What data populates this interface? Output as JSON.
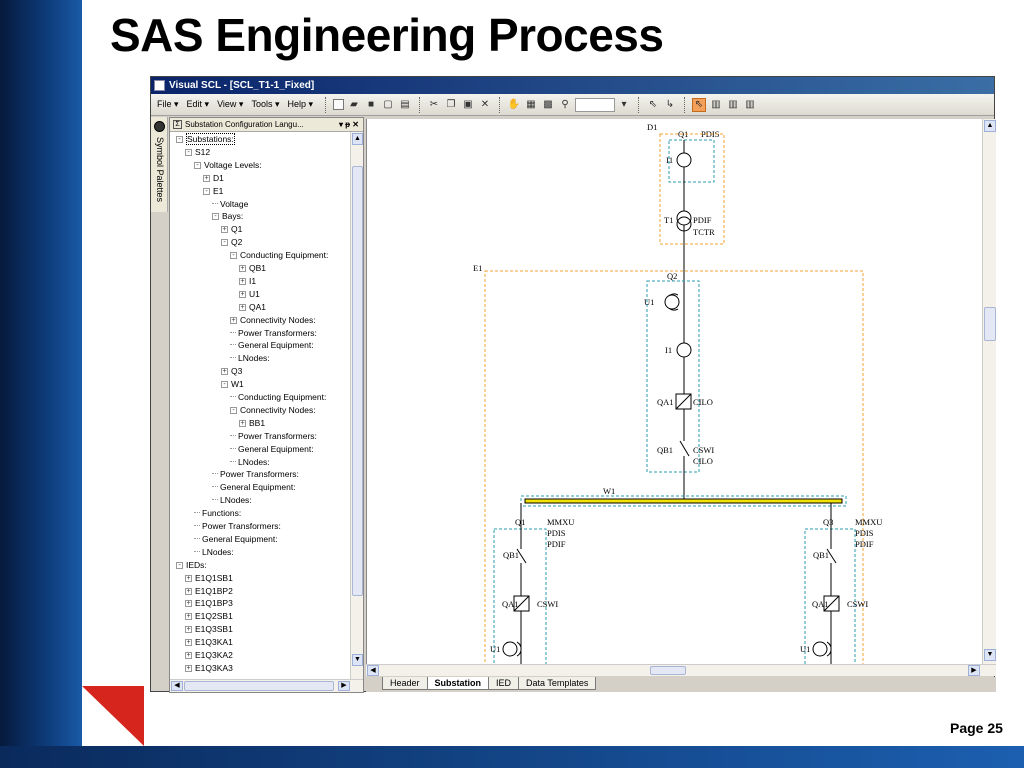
{
  "slide": {
    "title": "SAS Engineering Process",
    "page": "Page 25"
  },
  "window": {
    "title": "Visual SCL - [SCL_T1-1_Fixed]"
  },
  "menu": [
    "File ▾",
    "Edit ▾",
    "View ▾",
    "Tools ▾",
    "Help ▾"
  ],
  "palette": {
    "label": "Symbol Palettes"
  },
  "tree": {
    "header": "Substation Configuration Langu...",
    "header_controls": "▾ ᵽ ✕",
    "items": [
      {
        "label": "Substations:",
        "toggle": "-",
        "level": 0,
        "selected": true
      },
      {
        "label": "S12",
        "toggle": "-",
        "level": 1
      },
      {
        "label": "Voltage Levels:",
        "toggle": "-",
        "level": 2
      },
      {
        "label": "D1",
        "toggle": "+",
        "level": 3
      },
      {
        "label": "E1",
        "toggle": "-",
        "level": 3
      },
      {
        "label": "Voltage",
        "toggle": "",
        "level": 4
      },
      {
        "label": "Bays:",
        "toggle": "-",
        "level": 4
      },
      {
        "label": "Q1",
        "toggle": "+",
        "level": 5
      },
      {
        "label": "Q2",
        "toggle": "-",
        "level": 5
      },
      {
        "label": "Conducting Equipment:",
        "toggle": "-",
        "level": 6
      },
      {
        "label": "QB1",
        "toggle": "+",
        "level": 7
      },
      {
        "label": "I1",
        "toggle": "+",
        "level": 7
      },
      {
        "label": "U1",
        "toggle": "+",
        "level": 7
      },
      {
        "label": "QA1",
        "toggle": "+",
        "level": 7
      },
      {
        "label": "Connectivity Nodes:",
        "toggle": "+",
        "level": 6
      },
      {
        "label": "Power Transformers:",
        "toggle": "",
        "level": 6
      },
      {
        "label": "General Equipment:",
        "toggle": "",
        "level": 6
      },
      {
        "label": "LNodes:",
        "toggle": "",
        "level": 6
      },
      {
        "label": "Q3",
        "toggle": "+",
        "level": 5
      },
      {
        "label": "W1",
        "toggle": "-",
        "level": 5
      },
      {
        "label": "Conducting Equipment:",
        "toggle": "",
        "level": 6
      },
      {
        "label": "Connectivity Nodes:",
        "toggle": "-",
        "level": 6
      },
      {
        "label": "BB1",
        "toggle": "+",
        "level": 7
      },
      {
        "label": "Power Transformers:",
        "toggle": "",
        "level": 6
      },
      {
        "label": "General Equipment:",
        "toggle": "",
        "level": 6
      },
      {
        "label": "LNodes:",
        "toggle": "",
        "level": 6
      },
      {
        "label": "Power Transformers:",
        "toggle": "",
        "level": 4
      },
      {
        "label": "General Equipment:",
        "toggle": "",
        "level": 4
      },
      {
        "label": "LNodes:",
        "toggle": "",
        "level": 4
      },
      {
        "label": "Functions:",
        "toggle": "",
        "level": 2
      },
      {
        "label": "Power Transformers:",
        "toggle": "",
        "level": 2
      },
      {
        "label": "General Equipment:",
        "toggle": "",
        "level": 2
      },
      {
        "label": "LNodes:",
        "toggle": "",
        "level": 2
      },
      {
        "label": "IEDs:",
        "toggle": "-",
        "level": 0
      },
      {
        "label": "E1Q1SB1",
        "toggle": "+",
        "level": 1
      },
      {
        "label": "E1Q1BP2",
        "toggle": "+",
        "level": 1
      },
      {
        "label": "E1Q1BP3",
        "toggle": "+",
        "level": 1
      },
      {
        "label": "E1Q2SB1",
        "toggle": "+",
        "level": 1
      },
      {
        "label": "E1Q3SB1",
        "toggle": "+",
        "level": 1
      },
      {
        "label": "E1Q3KA1",
        "toggle": "+",
        "level": 1
      },
      {
        "label": "E1Q3KA2",
        "toggle": "+",
        "level": 1
      },
      {
        "label": "E1Q3KA3",
        "toggle": "+",
        "level": 1
      }
    ]
  },
  "diagram": {
    "d1": "D1",
    "d1_q1": "Q1",
    "d1_pdis": "PDIS",
    "d1_i1": "I1",
    "t1": "T1",
    "t1_pdif": "PDIF",
    "t1_tctr": "TCTR",
    "e1": "E1",
    "q2": "Q2",
    "q2_u1": "U1",
    "q2_i1": "I1",
    "q2_qa1": "QA1",
    "q2_cilo": "CILO",
    "q2_qb1": "QB1",
    "q2_cswi": "CSWI",
    "q2_cilo2": "CILO",
    "w1": "W1",
    "q1": "Q1",
    "q1_mmxu": "MMXU",
    "q1_pdis": "PDIS",
    "q1_pdif": "PDIF",
    "q1_qb1": "QB1",
    "q1_qa1": "QA1",
    "q1_cswi": "CSWI",
    "q1_u1": "U1",
    "q3": "Q3",
    "q3_mmxu": "MMXU",
    "q3_pdis": "PDIS",
    "q3_pdif": "PDIF",
    "q3_qb1": "QB1",
    "q3_qa1": "QA1",
    "q3_cswi": "CSWI",
    "q3_u1": "U1"
  },
  "tabs": [
    "Header",
    "Substation",
    "IED",
    "Data Templates"
  ],
  "active_tab": "Substation",
  "colors": {
    "orange_dash": "#f0a030",
    "teal_dash": "#2a9fb0",
    "busbar": "#f2e200"
  }
}
